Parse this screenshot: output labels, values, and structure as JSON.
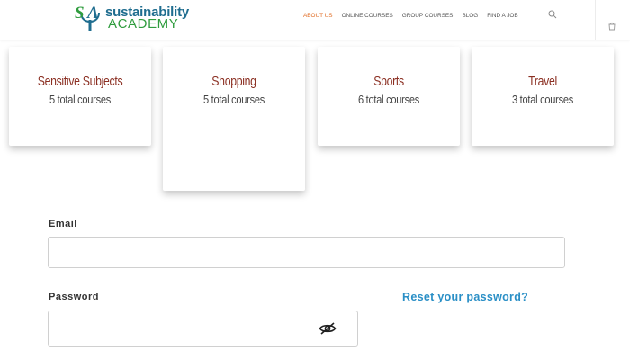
{
  "brand": {
    "name_top": "sustainability",
    "name_bottom": "ACADEMY",
    "monogram": "SA",
    "colors": {
      "blue": "#1f6d8f",
      "green": "#2f9c3e"
    }
  },
  "nav": {
    "items": [
      {
        "label": "ABOUT US",
        "active": true
      },
      {
        "label": "ONLINE COURSES",
        "active": false
      },
      {
        "label": "GROUP COURSES",
        "active": false
      },
      {
        "label": "BLOG",
        "active": false
      },
      {
        "label": "FIND A JOB",
        "active": false
      }
    ],
    "search_icon": "search-icon",
    "cart_icon": "cart-icon",
    "active_color": "#e06a20"
  },
  "categories": [
    {
      "title": "Sensitive Subjects",
      "count": "5 total courses"
    },
    {
      "title": "Shopping",
      "count": "5 total courses"
    },
    {
      "title": "Sports",
      "count": "6 total courses"
    },
    {
      "title": "Travel",
      "count": "3 total courses"
    }
  ],
  "form": {
    "email_label": "Email",
    "email_value": "",
    "password_label": "Password",
    "password_value": "",
    "reset_link": "Reset your password?",
    "toggle_icon": "eye-slash-icon",
    "link_color": "#2a8fc6"
  }
}
